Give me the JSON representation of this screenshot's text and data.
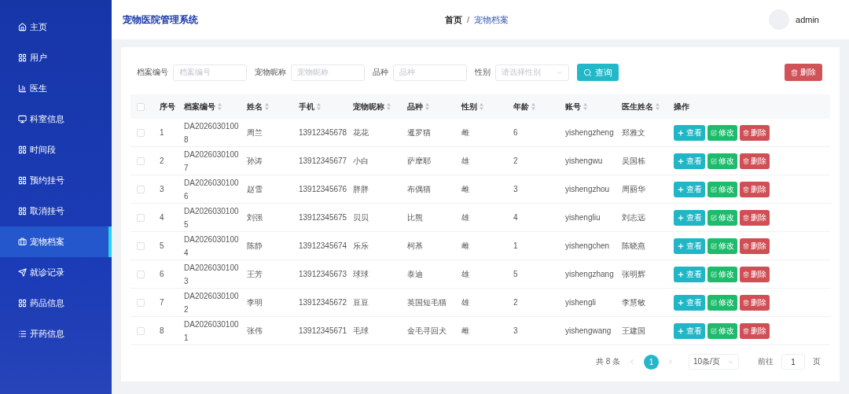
{
  "header": {
    "title": "宠物医院管理系统",
    "breadcrumb": [
      {
        "label": "首页",
        "current": false
      },
      {
        "label": "宠物档案",
        "current": true
      }
    ],
    "breadcrumb_separator": "/",
    "user": "admin"
  },
  "sidebar": {
    "items": [
      {
        "label": "主页",
        "kind": "home",
        "selected": false
      },
      {
        "label": "用户",
        "kind": "grid",
        "selected": false
      },
      {
        "label": "医生",
        "kind": "bar",
        "selected": false
      },
      {
        "label": "科室信息",
        "kind": "monitor",
        "selected": false
      },
      {
        "label": "时间段",
        "kind": "grid",
        "selected": false
      },
      {
        "label": "预约挂号",
        "kind": "grid",
        "selected": false
      },
      {
        "label": "取消挂号",
        "kind": "grid",
        "selected": false
      },
      {
        "label": "宠物档案",
        "kind": "briefcase",
        "selected": true
      },
      {
        "label": "就诊记录",
        "kind": "send",
        "selected": false
      },
      {
        "label": "药品信息",
        "kind": "grid",
        "selected": false
      },
      {
        "label": "开药信息",
        "kind": "list",
        "selected": false
      }
    ]
  },
  "filters": [
    {
      "label": "档案编号",
      "placeholder": "档案编号",
      "kind": "text"
    },
    {
      "label": "宠物昵称",
      "placeholder": "宠物昵称",
      "kind": "text"
    },
    {
      "label": "品种",
      "placeholder": "品种",
      "kind": "text"
    },
    {
      "label": "性别",
      "placeholder": "请选择性别",
      "kind": "select"
    }
  ],
  "search_button": "查询",
  "delete_button": "删除",
  "table": {
    "header_checked": false,
    "columns": [
      {
        "label": "序号",
        "sortable": false
      },
      {
        "label": "档案编号",
        "sortable": true
      },
      {
        "label": "姓名",
        "sortable": true
      },
      {
        "label": "手机",
        "sortable": true
      },
      {
        "label": "宠物昵称",
        "sortable": true
      },
      {
        "label": "品种",
        "sortable": true
      },
      {
        "label": "性别",
        "sortable": true
      },
      {
        "label": "年龄",
        "sortable": true
      },
      {
        "label": "账号",
        "sortable": true
      },
      {
        "label": "医生姓名",
        "sortable": true
      },
      {
        "label": "操作",
        "sortable": false
      }
    ],
    "rows": [
      {
        "checked": false,
        "cells": [
          "1",
          "DA20260301008",
          "周兰",
          "13912345678",
          "花花",
          "暹罗猫",
          "雌",
          "6",
          "yishengzheng",
          "郑雅文"
        ],
        "actions": [
          "查看",
          "修改",
          "删除"
        ]
      },
      {
        "checked": false,
        "cells": [
          "2",
          "DA20260301007",
          "孙涛",
          "13912345677",
          "小白",
          "萨摩耶",
          "雄",
          "2",
          "yishengwu",
          "吴国栋"
        ],
        "actions": [
          "查看",
          "修改",
          "删除"
        ]
      },
      {
        "checked": false,
        "cells": [
          "3",
          "DA20260301006",
          "赵雪",
          "13912345676",
          "胖胖",
          "布偶猫",
          "雌",
          "3",
          "yishengzhou",
          "周丽华"
        ],
        "actions": [
          "查看",
          "修改",
          "删除"
        ]
      },
      {
        "checked": false,
        "cells": [
          "4",
          "DA20260301005",
          "刘强",
          "13912345675",
          "贝贝",
          "比熊",
          "雄",
          "4",
          "yishengliu",
          "刘志远"
        ],
        "actions": [
          "查看",
          "修改",
          "删除"
        ]
      },
      {
        "checked": false,
        "cells": [
          "5",
          "DA20260301004",
          "陈静",
          "13912345674",
          "乐乐",
          "柯基",
          "雌",
          "1",
          "yishengchen",
          "陈晓燕"
        ],
        "actions": [
          "查看",
          "修改",
          "删除"
        ]
      },
      {
        "checked": false,
        "cells": [
          "6",
          "DA20260301003",
          "王芳",
          "13912345673",
          "球球",
          "泰迪",
          "雄",
          "5",
          "yishengzhang",
          "张明辉"
        ],
        "actions": [
          "查看",
          "修改",
          "删除"
        ]
      },
      {
        "checked": false,
        "cells": [
          "7",
          "DA20260301002",
          "李明",
          "13912345672",
          "豆豆",
          "英国短毛猫",
          "雄",
          "2",
          "yishengli",
          "李慧敏"
        ],
        "actions": [
          "查看",
          "修改",
          "删除"
        ]
      },
      {
        "checked": false,
        "cells": [
          "8",
          "DA20260301001",
          "张伟",
          "13912345671",
          "毛球",
          "金毛寻回犬",
          "雌",
          "3",
          "yishengwang",
          "王建国"
        ],
        "actions": [
          "查看",
          "修改",
          "删除"
        ]
      }
    ]
  },
  "pagination": {
    "total": "共 8 条",
    "pages": [
      {
        "label": "1",
        "selected": true
      }
    ],
    "page_size": "10条/页",
    "goto_label": "前往",
    "goto_value": "1",
    "goto_suffix": "页"
  }
}
